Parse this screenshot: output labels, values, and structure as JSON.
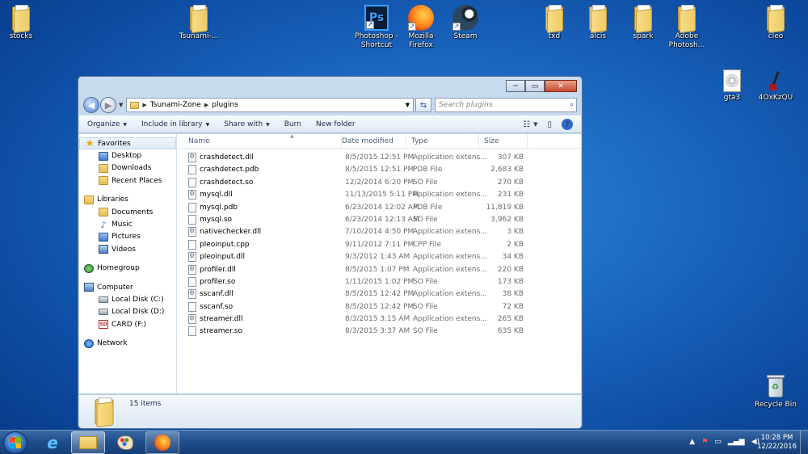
{
  "desktop": {
    "icons": [
      {
        "label": "stocks"
      },
      {
        "label": "Tsunami-..."
      },
      {
        "label": "Photoshop - Shortcut"
      },
      {
        "label": "Mozilla Firefox"
      },
      {
        "label": "Steam"
      },
      {
        "label": "txd"
      },
      {
        "label": "alcis"
      },
      {
        "label": "spark"
      },
      {
        "label": "Adobe Photosh..."
      },
      {
        "label": "cleo"
      },
      {
        "label": "gta3"
      },
      {
        "label": "4OxKzQU"
      },
      {
        "label": "Recycle Bin"
      }
    ],
    "photoshop_glyph": "Ps"
  },
  "window": {
    "breadcrumb": [
      "Tsunami-Zone",
      "plugins"
    ],
    "search_placeholder": "Search plugins",
    "caption": {
      "minimize": "─",
      "maximize": "▭",
      "close": "✕"
    },
    "toolbar": {
      "organize": "Organize",
      "include_in_library": "Include in library",
      "share_with": "Share with",
      "burn": "Burn",
      "new_folder": "New folder"
    },
    "nav": {
      "favorites": "Favorites",
      "desktop": "Desktop",
      "downloads": "Downloads",
      "recent_places": "Recent Places",
      "libraries": "Libraries",
      "documents": "Documents",
      "music": "Music",
      "pictures": "Pictures",
      "videos": "Videos",
      "homegroup": "Homegroup",
      "computer": "Computer",
      "local_disk_c": "Local Disk (C:)",
      "local_disk_d": "Local Disk (D:)",
      "card_f": "CARD (F:)",
      "network": "Network"
    },
    "columns": {
      "name": "Name",
      "date_modified": "Date modified",
      "type": "Type",
      "size": "Size"
    },
    "files": [
      {
        "name": "crashdetect.dll",
        "date": "8/5/2015 12:51 PM",
        "type": "Application extens...",
        "size": "307 KB",
        "icon": "gear"
      },
      {
        "name": "crashdetect.pdb",
        "date": "8/5/2015 12:51 PM",
        "type": "PDB File",
        "size": "2,683 KB",
        "icon": "file"
      },
      {
        "name": "crashdetect.so",
        "date": "12/2/2014 6:20 PM",
        "type": "SO File",
        "size": "270 KB",
        "icon": "file"
      },
      {
        "name": "mysql.dll",
        "date": "11/13/2015 5:11 PM",
        "type": "Application extens...",
        "size": "231 KB",
        "icon": "gear"
      },
      {
        "name": "mysql.pdb",
        "date": "6/23/2014 12:02 AM",
        "type": "PDB File",
        "size": "11,819 KB",
        "icon": "file"
      },
      {
        "name": "mysql.so",
        "date": "6/23/2014 12:13 AM",
        "type": "SO File",
        "size": "3,962 KB",
        "icon": "file"
      },
      {
        "name": "nativechecker.dll",
        "date": "7/10/2014 4:50 PM",
        "type": "Application extens...",
        "size": "3 KB",
        "icon": "gear"
      },
      {
        "name": "pleoinput.cpp",
        "date": "9/11/2012 7:11 PM",
        "type": "CPP File",
        "size": "2 KB",
        "icon": "file"
      },
      {
        "name": "pleoinput.dll",
        "date": "9/3/2012 1:43 AM",
        "type": "Application extens...",
        "size": "34 KB",
        "icon": "gear"
      },
      {
        "name": "profiler.dll",
        "date": "8/5/2015 1:07 PM",
        "type": "Application extens...",
        "size": "220 KB",
        "icon": "gear"
      },
      {
        "name": "profiler.so",
        "date": "1/11/2015 1:02 PM",
        "type": "SO File",
        "size": "173 KB",
        "icon": "file"
      },
      {
        "name": "sscanf.dll",
        "date": "8/5/2015 12:42 PM",
        "type": "Application extens...",
        "size": "38 KB",
        "icon": "gear"
      },
      {
        "name": "sscanf.so",
        "date": "8/5/2015 12:42 PM",
        "type": "SO File",
        "size": "72 KB",
        "icon": "file"
      },
      {
        "name": "streamer.dll",
        "date": "8/3/2015 3:15 AM",
        "type": "Application extens...",
        "size": "265 KB",
        "icon": "gear"
      },
      {
        "name": "streamer.so",
        "date": "8/3/2015 3:37 AM",
        "type": "SO File",
        "size": "635 KB",
        "icon": "file"
      }
    ],
    "item_count": "15 items"
  },
  "taskbar": {
    "time": "10:28 PM",
    "date": "12/22/2016"
  },
  "colors": {
    "desktop_bg": "#1a66c0",
    "taskbar_bg": "#1f4f8c",
    "window_frame": "#c9dbee"
  }
}
